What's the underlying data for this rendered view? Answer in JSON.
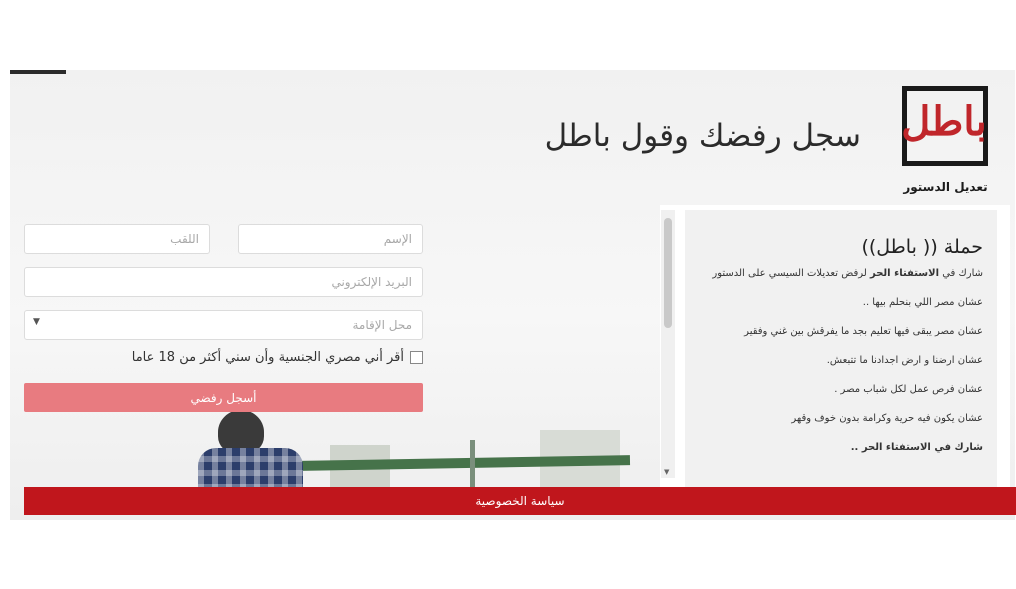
{
  "brand": {
    "logo_word": "باطل",
    "logo_sub": "تعديل الدستور",
    "headline": "سجل رفضك وقول باطل"
  },
  "form": {
    "first_name_placeholder": "الإسم",
    "last_name_placeholder": "اللقب",
    "email_placeholder": "البريد الإلكتروني",
    "residence_placeholder": "محل الإقامة",
    "agree_label": "أقر أني مصري الجنسية وأن سني أكثر من 18 عاما",
    "submit_label": "أسجل رفضي"
  },
  "campaign": {
    "title": "حملة (( باطل))",
    "intro_prefix": "شارك في",
    "intro_bold": "الاستفتاء الحر",
    "intro_suffix": "لرفض تعديلات السيسي على الدستور",
    "items": [
      "عشان مصر اللي بنحلم بيها ..",
      "عشان مصر يبقى فيها تعليم بجد ما يفرقش بين غني وفقير",
      "عشان ارضنا و ارض اجدادنا ما تتبعش.",
      "عشان فرص عمل لكل شباب مصر .",
      "عشان يكون فيه حرية وكرامة بدون خوف وقهر"
    ],
    "closing": "شارك في الاستفتاء الحر .."
  },
  "footer": {
    "privacy_label": "سياسة الخصوصية"
  },
  "colors": {
    "brand_red": "#c0161c",
    "submit_pink": "#e87b80"
  }
}
